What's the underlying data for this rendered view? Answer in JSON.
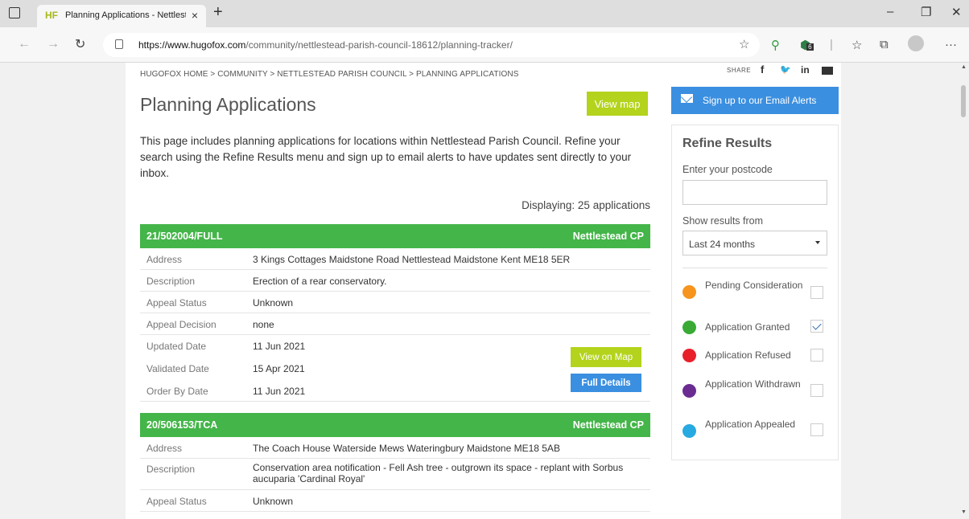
{
  "browser": {
    "tab": {
      "favicon_text": "HF",
      "title": "Planning Applications - Nettlestead",
      "close": "×"
    },
    "new_tab": "+",
    "window_controls": {
      "minimize": "–",
      "restore": "❐",
      "close": "✕"
    },
    "url": {
      "domain": "https://www.hugofox.com",
      "path": "/community/nettlestead-parish-council-18612/planning-tracker/"
    },
    "icons": [
      "back-arrow-icon",
      "forward-arrow-icon",
      "refresh-icon",
      "lock-icon",
      "favorites-star-icon",
      "extension-pin-icon",
      "extension-shield-icon",
      "collections-icon",
      "browser-extensions-icon",
      "profile-avatar-icon",
      "more-menu-icon"
    ],
    "extension_badge": "6"
  },
  "page": {
    "breadcrumb": "HUGOFOX HOME > COMMUNITY > NETTLESTEAD PARISH COUNCIL > PLANNING APPLICATIONS",
    "share_label": "SHARE",
    "social": {
      "facebook": "f",
      "twitter": "🐦",
      "linkedin": "in"
    },
    "title": "Planning Applications",
    "view_map": "View map",
    "intro": "This page includes planning applications for locations within Nettlestead Parish Council. Refine your search using the Refine Results menu and sign up to email alerts to have updates sent directly to your inbox.",
    "displaying": "Displaying: 25 applications",
    "applications": [
      {
        "ref": "21/502004/FULL",
        "area": "Nettlestead CP",
        "rows": [
          {
            "label": "Address",
            "value": "3 Kings Cottages Maidstone Road Nettlestead Maidstone Kent ME18 5ER"
          },
          {
            "label": "Description",
            "value": "Erection of a rear conservatory."
          },
          {
            "label": "Appeal Status",
            "value": "Unknown"
          },
          {
            "label": "Appeal Decision",
            "value": "none"
          },
          {
            "label": "Updated Date",
            "value": "11 Jun 2021"
          },
          {
            "label": "Validated Date",
            "value": "15 Apr 2021"
          },
          {
            "label": "Order By Date",
            "value": "11 Jun 2021"
          }
        ],
        "view_on_map": "View on Map",
        "full_details": "Full Details"
      },
      {
        "ref": "20/506153/TCA",
        "area": "Nettlestead CP",
        "rows": [
          {
            "label": "Address",
            "value": "The Coach House Waterside Mews Wateringbury Maidstone ME18 5AB"
          },
          {
            "label": "Description",
            "value": "Conservation area notification - Fell Ash tree - outgrown its space - replant with Sorbus aucuparia 'Cardinal Royal'"
          },
          {
            "label": "Appeal Status",
            "value": "Unknown"
          }
        ]
      }
    ]
  },
  "sidebar": {
    "email_alerts": "Sign up to our Email Alerts",
    "refine_title": "Refine Results",
    "postcode_label": "Enter your postcode",
    "postcode_value": "",
    "show_results_label": "Show results from",
    "show_results_value": "Last 24 months",
    "statuses": [
      {
        "label": "Pending Consideration",
        "color": "#f7941d",
        "checked": false
      },
      {
        "label": "Application Granted",
        "color": "#3aaa35",
        "checked": true
      },
      {
        "label": "Application Refused",
        "color": "#e8202a",
        "checked": false
      },
      {
        "label": "Application Withdrawn",
        "color": "#6a2c91",
        "checked": false
      },
      {
        "label": "Application Appealed",
        "color": "#27a9e1",
        "checked": false
      }
    ]
  }
}
